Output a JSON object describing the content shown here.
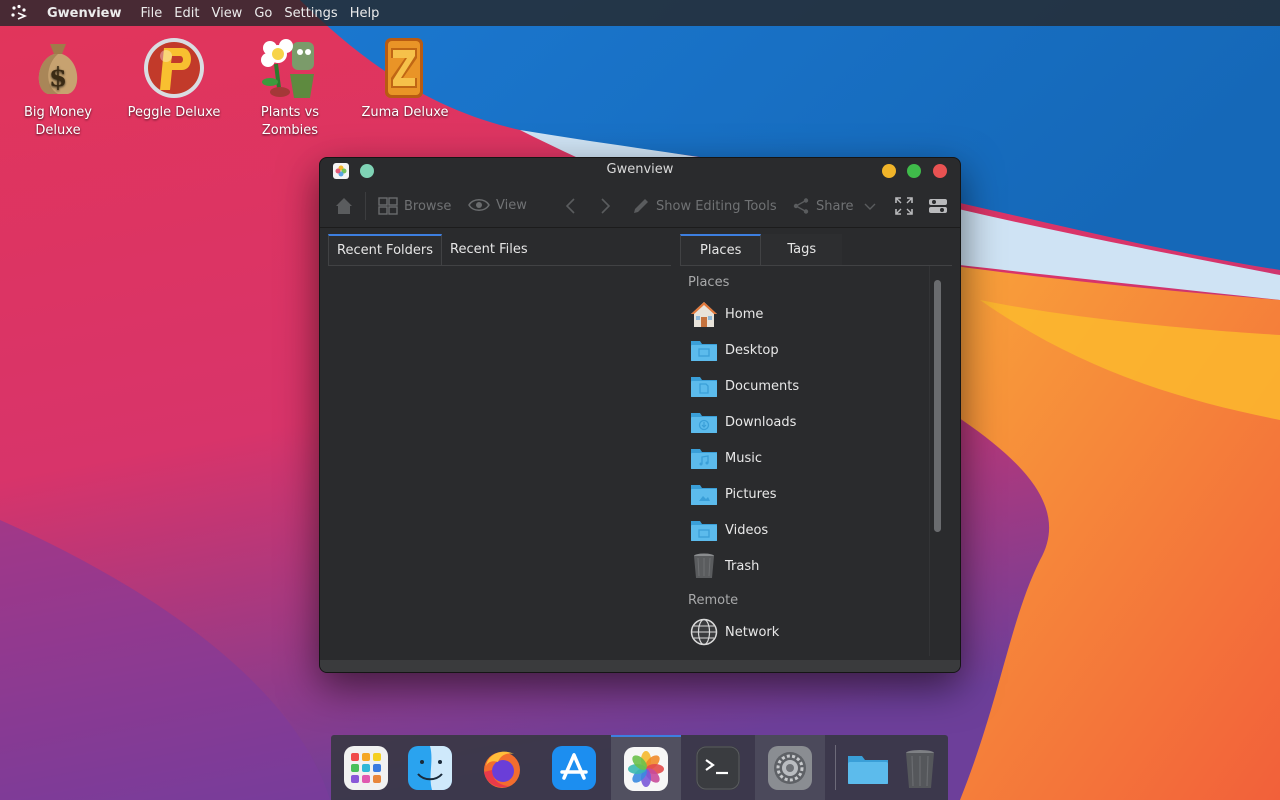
{
  "menubar": {
    "app_name": "Gwenview",
    "items": [
      "File",
      "Edit",
      "View",
      "Go",
      "Settings",
      "Help"
    ]
  },
  "desktop_icons": [
    {
      "label": "Big Money\nDeluxe",
      "icon": "money-bag-icon"
    },
    {
      "label": "Peggle Deluxe",
      "icon": "peggle-icon"
    },
    {
      "label": "Plants vs\nZombies",
      "icon": "plants-vs-zombies-icon"
    },
    {
      "label": "Zuma Deluxe",
      "icon": "zuma-icon"
    }
  ],
  "window": {
    "title": "Gwenview",
    "toolbar": {
      "browse": "Browse",
      "view": "View",
      "show_editing_tools": "Show Editing Tools",
      "share": "Share"
    },
    "left_tabs": [
      "Recent Folders",
      "Recent Files"
    ],
    "right_tabs": [
      "Places",
      "Tags"
    ],
    "places_section": "Places",
    "places": [
      "Home",
      "Desktop",
      "Documents",
      "Downloads",
      "Music",
      "Pictures",
      "Videos",
      "Trash"
    ],
    "remote_section": "Remote",
    "remote": [
      "Network"
    ]
  },
  "dock": {
    "items": [
      "app-launcher-icon",
      "finder-icon",
      "firefox-icon",
      "app-store-icon",
      "photos-icon",
      "terminal-icon",
      "system-settings-icon",
      "folder-icon",
      "trash-icon"
    ]
  },
  "colors": {
    "accent": "#3d7fe0",
    "window_bg": "#2a2b2d",
    "close": "#e85252",
    "minimize": "#f0b429",
    "maximize": "#3fbb4a",
    "keep_above": "#7fd3b5"
  }
}
